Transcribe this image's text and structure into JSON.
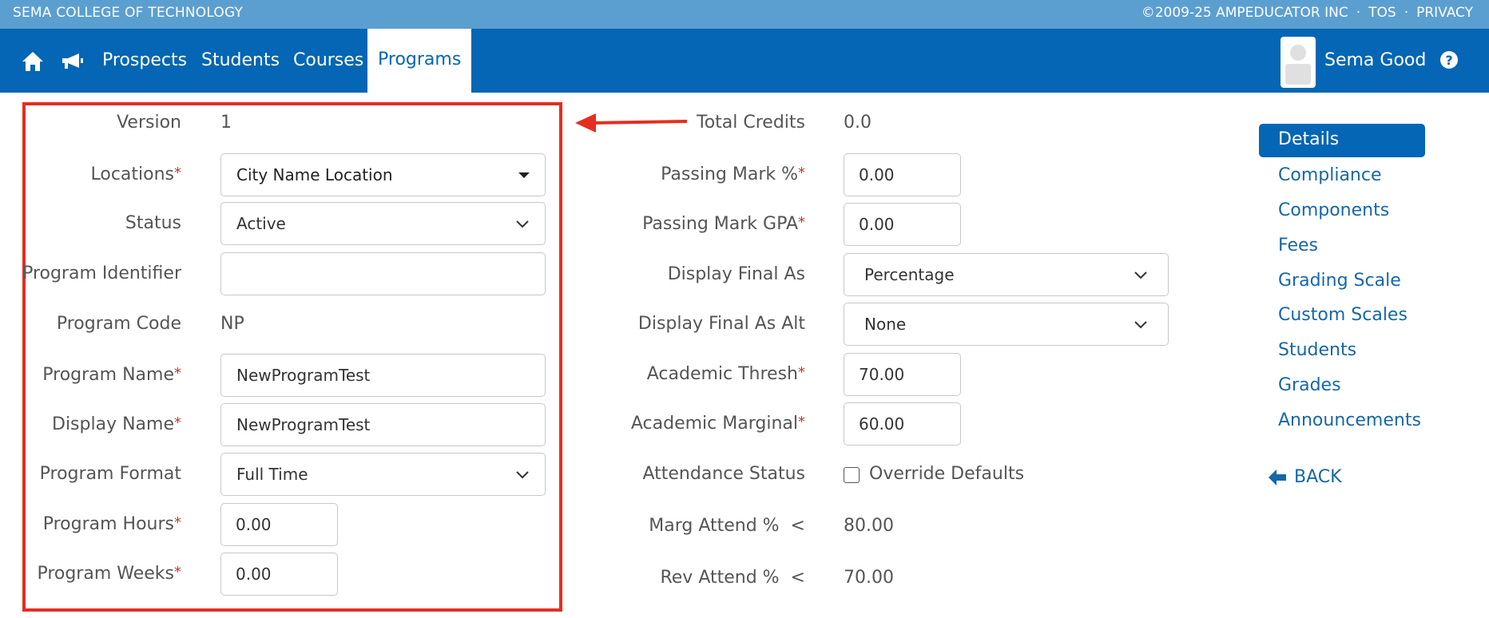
{
  "topbar": {
    "school": "SEMA COLLEGE OF TECHNOLOGY",
    "copyright": "©2009-25 AMPEDUCATOR INC",
    "sep": "·",
    "tos": "TOS",
    "privacy": "PRIVACY"
  },
  "nav": {
    "home_icon": "home-icon",
    "announce_icon": "megaphone-icon",
    "prospects": "Prospects",
    "students": "Students",
    "courses": "Courses",
    "programs": "Programs",
    "user_name": "Sema Good",
    "help_icon": "question-circle-icon"
  },
  "form_left": {
    "version": {
      "label": "Version",
      "value": "1"
    },
    "locations": {
      "label": "Locations",
      "value": "City Name Location"
    },
    "status": {
      "label": "Status",
      "value": "Active"
    },
    "program_identifier": {
      "label": "Program Identifier",
      "value": ""
    },
    "program_code": {
      "label": "Program Code",
      "value": "NP"
    },
    "program_name": {
      "label": "Program Name",
      "value": "NewProgramTest"
    },
    "display_name": {
      "label": "Display Name",
      "value": "NewProgramTest"
    },
    "program_format": {
      "label": "Program Format",
      "value": "Full Time"
    },
    "program_hours": {
      "label": "Program Hours",
      "value": "0.00"
    },
    "program_weeks": {
      "label": "Program Weeks",
      "value": "0.00"
    }
  },
  "form_right": {
    "total_credits": {
      "label": "Total Credits",
      "value": "0.0"
    },
    "passing_mark_pct": {
      "label": "Passing Mark %",
      "value": "0.00"
    },
    "passing_mark_gpa": {
      "label": "Passing Mark GPA",
      "value": "0.00"
    },
    "display_final_as": {
      "label": "Display Final As",
      "value": "Percentage"
    },
    "display_final_as_alt": {
      "label": "Display Final As Alt",
      "value": "None"
    },
    "academic_thresh": {
      "label": "Academic Thresh",
      "value": "70.00"
    },
    "academic_marginal": {
      "label": "Academic Marginal",
      "value": "60.00"
    },
    "attendance_status": {
      "label": "Attendance Status",
      "checkbox_label": "Override Defaults"
    },
    "marg_attend": {
      "label": "Marg Attend %  <",
      "value": "80.00"
    },
    "rev_attend": {
      "label": "Rev Attend %  <",
      "value": "70.00"
    }
  },
  "required_mark": "*",
  "sidebar": {
    "items": [
      "Details",
      "Compliance",
      "Components",
      "Fees",
      "Grading Scale",
      "Custom Scales",
      "Students",
      "Grades",
      "Announcements"
    ],
    "back": "BACK"
  },
  "colors": {
    "topbar": "#5b9fd0",
    "navbar": "#0466b4",
    "highlight_box": "#e52e1f",
    "link": "#1667a8"
  }
}
